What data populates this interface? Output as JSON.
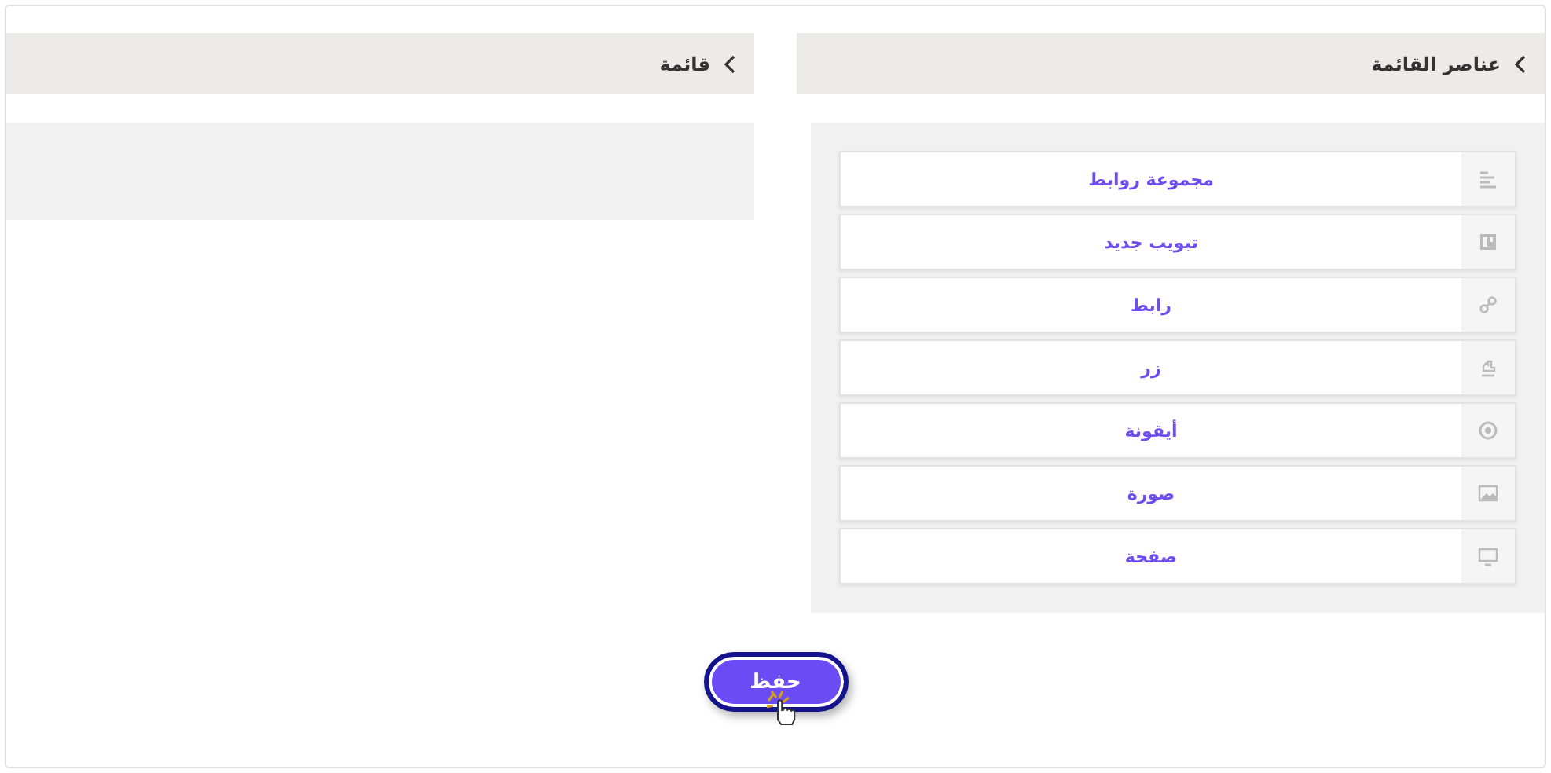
{
  "panels": [
    {
      "title": "عناصر القائمة",
      "items": [
        {
          "label": "مجموعة روابط",
          "kind": "group"
        },
        {
          "label": "تبويب جديد",
          "kind": "tab"
        },
        {
          "label": "رابط",
          "kind": "link"
        },
        {
          "label": "زر",
          "kind": "button"
        },
        {
          "label": "أيقونة",
          "kind": "icon"
        },
        {
          "label": "صورة",
          "kind": "image"
        },
        {
          "label": "صفحة",
          "kind": "page"
        }
      ]
    },
    {
      "title": "قائمة"
    }
  ],
  "save_button": {
    "label": "حفظ"
  }
}
